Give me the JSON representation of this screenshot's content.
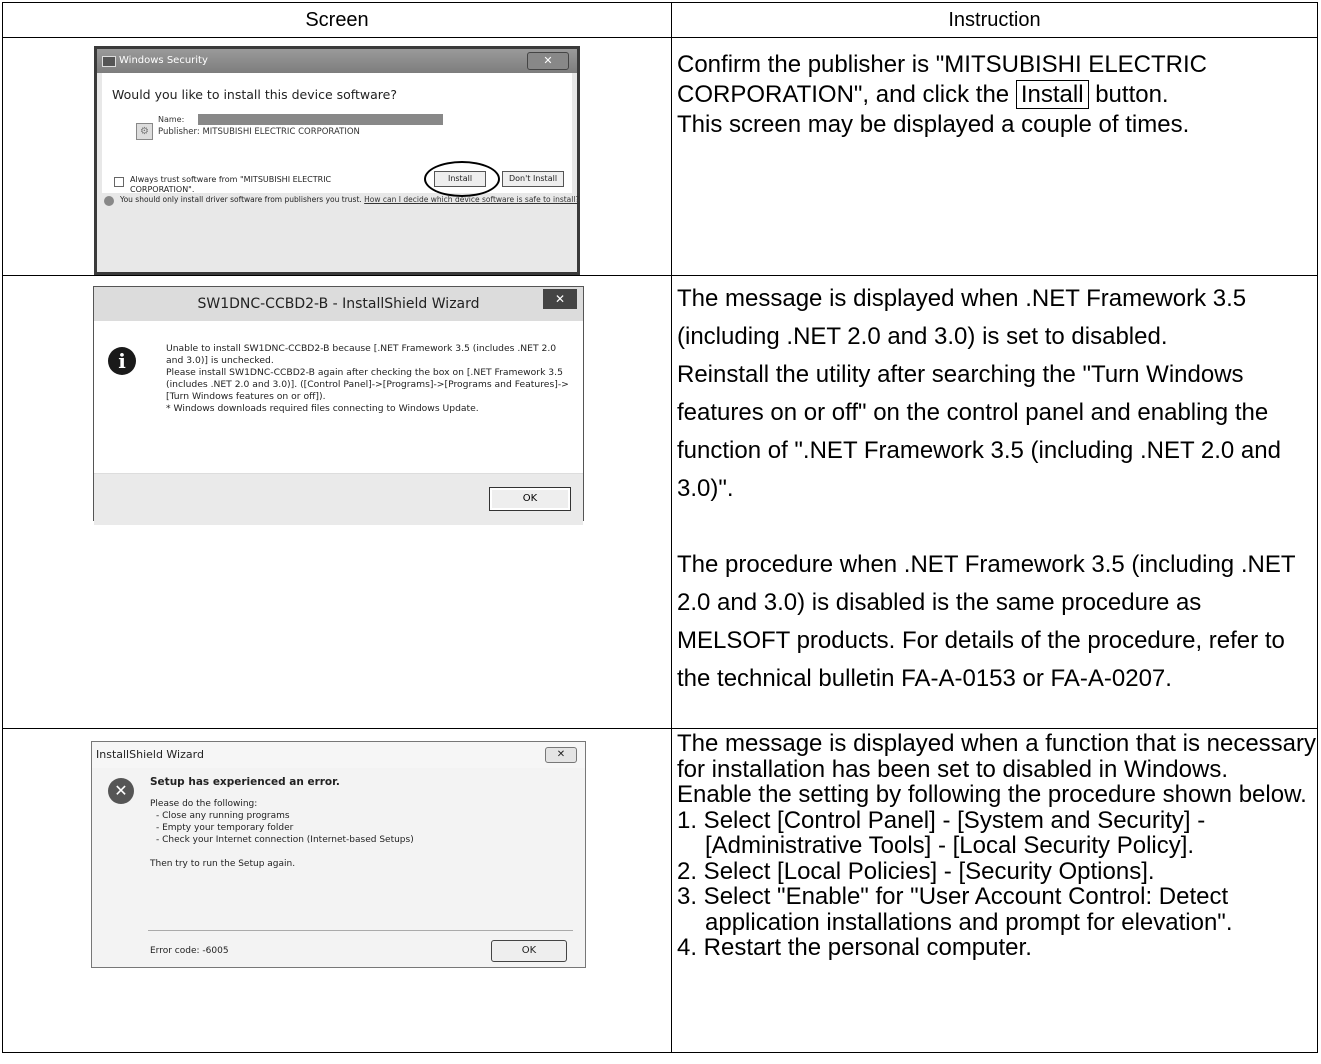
{
  "header": {
    "screen": "Screen",
    "instruction": "Instruction"
  },
  "row1": {
    "dialog": {
      "title": "Windows Security",
      "close": "✕",
      "question": "Would you like to install this device software?",
      "name_label": "Name:",
      "publisher": "Publisher: MITSUBISHI ELECTRIC CORPORATION",
      "always_trust": "Always trust software from \"MITSUBISHI ELECTRIC CORPORATION\".",
      "install_button": "Install",
      "dont_install_button": "Don't Install",
      "footer_text": "You should only install driver software from publishers you trust.",
      "footer_link": "How can I decide which device software is safe to install?"
    },
    "instruction": {
      "part1": "Confirm the publisher is \"MITSUBISHI ELECTRIC CORPORATION\", and click the",
      "button": "Install",
      "part2": "button.",
      "line2": "This screen may be displayed a couple of times."
    }
  },
  "row2": {
    "dialog": {
      "title": "SW1DNC-CCBD2-B - InstallShield Wizard",
      "close": "✕",
      "icon": "i",
      "message": [
        "Unable to install SW1DNC-CCBD2-B because [.NET Framework 3.5 (includes .NET 2.0 and 3.0)] is unchecked.",
        "Please install SW1DNC-CCBD2-B again after checking the box on [.NET Framework 3.5 (includes .NET 2.0 and 3.0)]. ([Control Panel]->[Programs]->[Programs and Features]->[Turn Windows features on or off]).",
        "* Windows downloads required files connecting to Windows Update."
      ],
      "ok_button": "OK"
    },
    "instruction": {
      "p1": "The message is displayed when .NET Framework 3.5 (including .NET 2.0 and 3.0) is set to disabled.",
      "p2": "Reinstall the utility after searching the \"Turn Windows features on or off\" on the control panel and enabling the function of \".NET Framework 3.5 (including .NET 2.0 and 3.0)\".",
      "p3": "The procedure when .NET Framework 3.5 (including .NET 2.0 and 3.0) is disabled is the same procedure as MELSOFT products. For details of the procedure, refer to the technical bulletin FA-A-0153 or FA-A-0207."
    }
  },
  "row3": {
    "dialog": {
      "title": "InstallShield Wizard",
      "close": "✕",
      "icon": "✕",
      "heading": "Setup has experienced an error.",
      "lines": [
        "Please do the following:",
        "- Close any running programs",
        "- Empty your temporary folder",
        "- Check your Internet connection (Internet-based Setups)",
        "",
        "Then try to run the Setup again."
      ],
      "error_code": "Error code:  -6005",
      "ok_button": "OK"
    },
    "instruction": {
      "p1": "The message is displayed when a function that is necessary for installation has been set to disabled in Windows.",
      "p2": "Enable the setting by following the procedure shown below.",
      "s1a": "1. Select [Control Panel] - [System and Security] -",
      "s1b": "[Administrative Tools] - [Local Security Policy].",
      "s2": "2. Select [Local Policies] - [Security Options].",
      "s3a": "3. Select \"Enable\" for \"User Account Control: Detect",
      "s3b": "application installations and prompt for elevation\".",
      "s4": "4. Restart the personal computer."
    }
  }
}
